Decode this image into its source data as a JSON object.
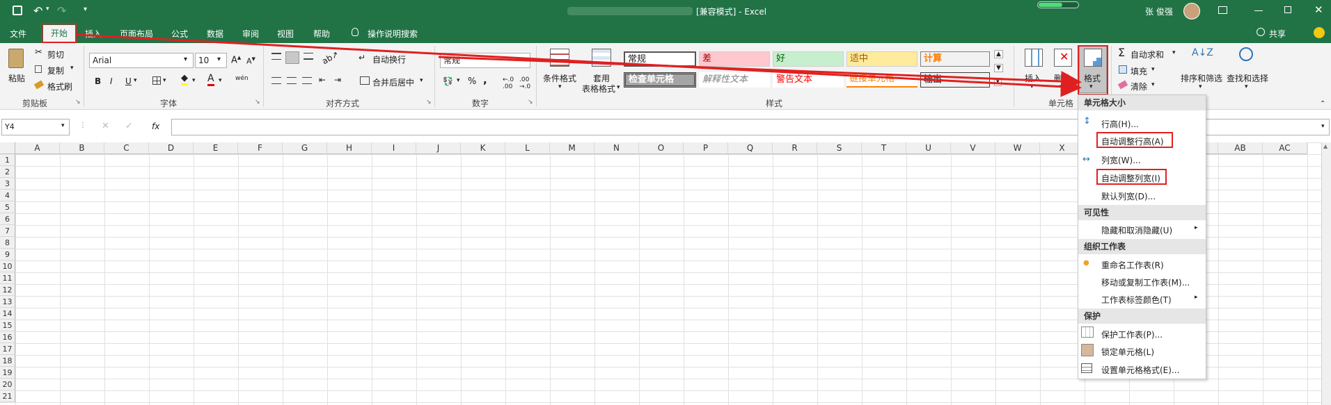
{
  "titlebar": {
    "doc_title": "[兼容模式]  -  Excel",
    "user_name": "张 俊强"
  },
  "tabs": [
    "文件",
    "开始",
    "插入",
    "页面布局",
    "公式",
    "数据",
    "审阅",
    "视图",
    "帮助",
    "操作说明搜索"
  ],
  "share_label": "共享",
  "ribbon": {
    "clipboard": {
      "paste": "粘贴",
      "cut": "剪切",
      "copy": "复制",
      "format_painter": "格式刷",
      "group": "剪贴板"
    },
    "font": {
      "name": "Arial",
      "size": "10",
      "group": "字体",
      "bold": "B",
      "italic": "I",
      "underline": "U",
      "font_color_glyph": "A",
      "phonetic_glyph": "wén"
    },
    "alignment": {
      "wrap": "自动换行",
      "merge": "合并后居中",
      "group": "对齐方式"
    },
    "number": {
      "format": "常规",
      "percent": "%",
      "group": "数字"
    },
    "styles": {
      "conditional": "条件格式",
      "table_line1": "套用",
      "table_line2": "表格格式",
      "cells": [
        {
          "label": "常规",
          "bg": "#ffffff",
          "color": "#222222"
        },
        {
          "label": "差",
          "bg": "#ffc7ce",
          "color": "#9c0006"
        },
        {
          "label": "好",
          "bg": "#c6efce",
          "color": "#006100"
        },
        {
          "label": "适中",
          "bg": "#ffeb9c",
          "color": "#9c5700"
        },
        {
          "label": "计算",
          "bg": "#f2f2f2",
          "color": "#fa7d00"
        },
        {
          "label": "检查单元格",
          "bg": "#a5a5a5",
          "color": "#ffffff"
        },
        {
          "label": "解释性文本",
          "bg": "#ffffff",
          "color": "#7f7f7f"
        },
        {
          "label": "警告文本",
          "bg": "#ffffff",
          "color": "#ff0000"
        },
        {
          "label": "链接单元格",
          "bg": "#ffffff",
          "color": "#fa7d00"
        },
        {
          "label": "输出",
          "bg": "#f2f2f2",
          "color": "#3f3f3f"
        }
      ],
      "group": "样式"
    },
    "cells": {
      "insert": "插入",
      "delete": "删除",
      "format": "格式",
      "group": "单元格"
    },
    "editing": {
      "autosum": "自动求和",
      "fill": "填充",
      "clear": "清除",
      "sort": "排序和筛选",
      "find": "查找和选择"
    }
  },
  "formula": {
    "name_box": "Y4",
    "fx": "fx",
    "value": ""
  },
  "columns": [
    "A",
    "B",
    "C",
    "D",
    "E",
    "F",
    "G",
    "H",
    "I",
    "J",
    "K",
    "L",
    "M",
    "N",
    "O",
    "P",
    "Q",
    "R",
    "S",
    "T",
    "U",
    "V",
    "W",
    "X",
    "",
    "",
    "",
    "AB",
    "AC"
  ],
  "rows": [
    "1",
    "2",
    "3",
    "4",
    "5",
    "6",
    "7",
    "8",
    "9",
    "10",
    "11",
    "12",
    "13",
    "14",
    "15",
    "16",
    "17",
    "18",
    "19",
    "20",
    "21"
  ],
  "menu": {
    "sections": [
      {
        "header": "单元格大小",
        "items": [
          "行高(H)...",
          "自动调整行高(A)",
          "列宽(W)...",
          "自动调整列宽(I)",
          "默认列宽(D)..."
        ]
      },
      {
        "header": "可见性",
        "items": [
          "隐藏和取消隐藏(U)"
        ]
      },
      {
        "header": "组织工作表",
        "items": [
          "重命名工作表(R)",
          "移动或复制工作表(M)...",
          "工作表标签颜色(T)"
        ]
      },
      {
        "header": "保护",
        "items": [
          "保护工作表(P)...",
          "锁定单元格(L)",
          "设置单元格格式(E)..."
        ]
      }
    ]
  },
  "colors": {
    "excel_green": "#217346",
    "annotation_red": "#e02020"
  }
}
